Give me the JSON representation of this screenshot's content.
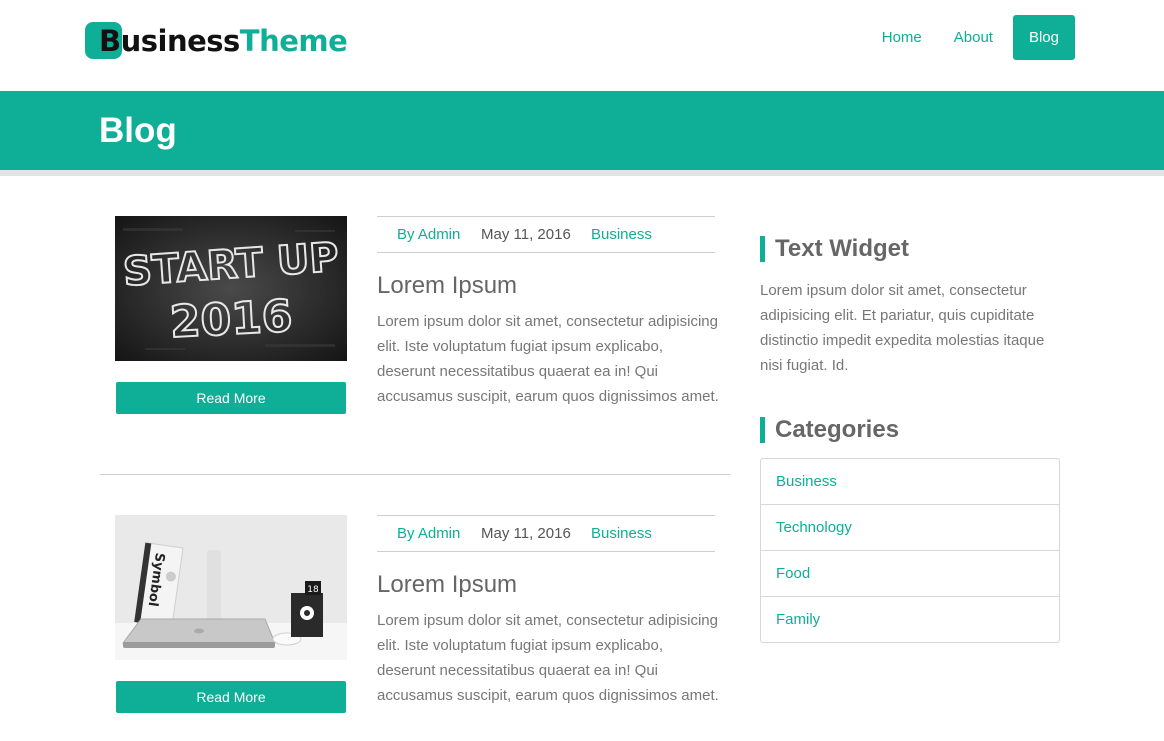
{
  "brand": {
    "word1": "Business",
    "word2": "Theme",
    "accent": "#0fae96"
  },
  "nav": [
    {
      "label": "Home",
      "active": false
    },
    {
      "label": "About",
      "active": false
    },
    {
      "label": "Blog",
      "active": true
    }
  ],
  "banner": {
    "title": "Blog"
  },
  "posts": [
    {
      "image": "startup-2016-chalkboard-image",
      "image_text": [
        "START UP",
        "2016"
      ],
      "read_more": "Read More",
      "author": "By Admin",
      "date": "May 11, 2016",
      "category": "Business",
      "title": "Lorem Ipsum",
      "excerpt": "Lorem ipsum dolor sit amet, consectetur adipisicing elit. Iste voluptatum fugiat ipsum explicabo, deserunt necessitatibus quaerat ea in! Qui accusamus suscipit, earum quos dignissimos amet."
    },
    {
      "image": "laptop-desk-image",
      "image_text": [
        "Symbol",
        "18"
      ],
      "read_more": "Read More",
      "author": "By Admin",
      "date": "May 11, 2016",
      "category": "Business",
      "title": "Lorem Ipsum",
      "excerpt": "Lorem ipsum dolor sit amet, consectetur adipisicing elit. Iste voluptatum fugiat ipsum explicabo, deserunt necessitatibus quaerat ea in! Qui accusamus suscipit, earum quos dignissimos amet."
    }
  ],
  "sidebar": {
    "text_widget": {
      "title": "Text Widget",
      "body": "Lorem ipsum dolor sit amet, consectetur adipisicing elit. Et pariatur, quis cupiditate distinctio impedit expedita molestias itaque nisi fugiat. Id."
    },
    "categories": {
      "title": "Categories",
      "items": [
        "Business",
        "Technology",
        "Food",
        "Family"
      ]
    }
  }
}
